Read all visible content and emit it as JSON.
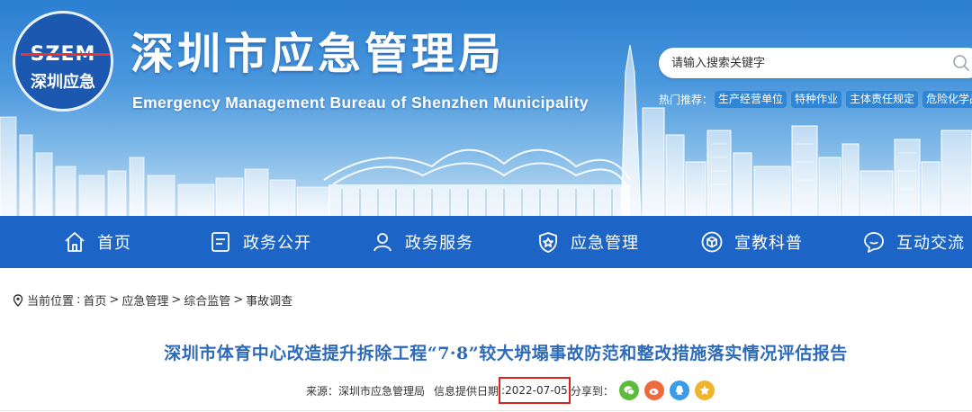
{
  "header": {
    "logo_top": "SZEM",
    "logo_bottom": "深圳应急",
    "title": "深圳市应急管理局",
    "subtitle": "Emergency Management Bureau of Shenzhen Municipality",
    "search_placeholder": "请输入搜索关键字",
    "hot_label": "热门推荐：",
    "hot_tags": [
      "生产经营单位",
      "特种作业",
      "主体责任规定",
      "危险化学品"
    ]
  },
  "nav": {
    "items": [
      {
        "label": "首页",
        "icon": "home-icon"
      },
      {
        "label": "政务公开",
        "icon": "document-icon"
      },
      {
        "label": "政务服务",
        "icon": "user-icon"
      },
      {
        "label": "应急管理",
        "icon": "shield-icon"
      },
      {
        "label": "宣教科普",
        "icon": "cube-icon"
      },
      {
        "label": "互动交流",
        "icon": "chat-icon"
      }
    ]
  },
  "breadcrumb": {
    "prefix": "当前位置",
    "items": [
      "首页",
      "应急管理",
      "综合监管",
      "事故调查"
    ]
  },
  "article": {
    "title": "深圳市体育中心改造提升拆除工程“7·8”较大坍塌事故防范和整改措施落实情况评估报告",
    "source_label": "来源：深圳市应急管理局",
    "date_label": "信息提供日期",
    "date": "2022-07-05",
    "share_label": "分享到：",
    "share": [
      {
        "name": "wechat-icon",
        "color": "#5dbb3c"
      },
      {
        "name": "weibo-icon",
        "color": "#ef6a3a"
      },
      {
        "name": "qq-icon",
        "color": "#3a9be6"
      },
      {
        "name": "qzone-icon",
        "color": "#f0b52a"
      }
    ]
  },
  "colors": {
    "nav_bg": "#1c65c6",
    "title_blue": "#2d6bb8",
    "highlight_red": "#e02020"
  }
}
